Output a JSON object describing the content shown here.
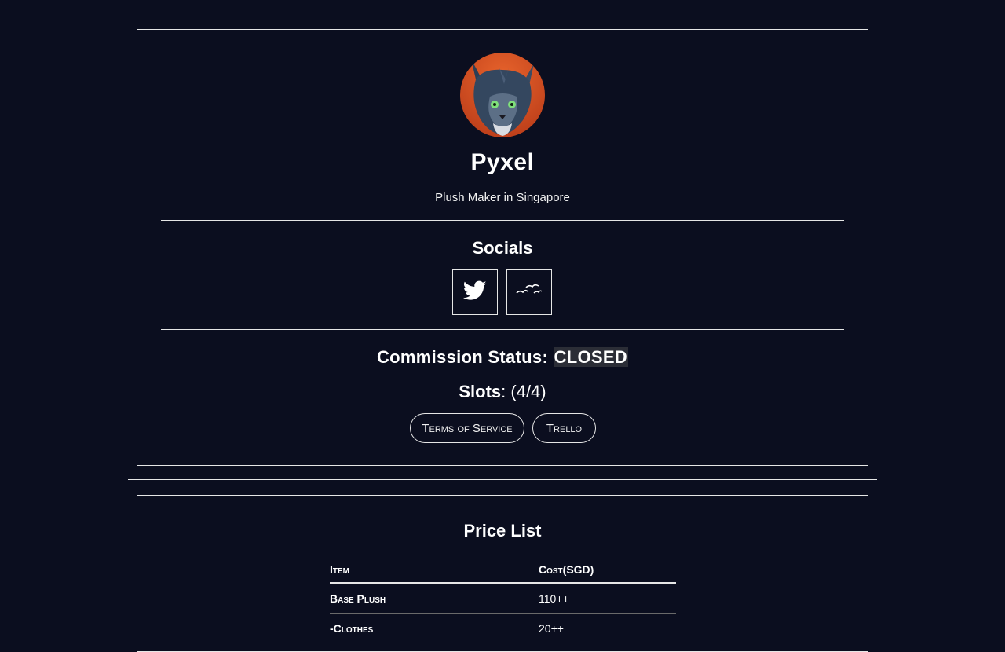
{
  "profile": {
    "name": "Pyxel",
    "subtitle": "Plush Maker in Singapore"
  },
  "socials": {
    "title": "Socials",
    "items": [
      {
        "icon": "twitter-icon"
      },
      {
        "icon": "furaffinity-icon"
      }
    ]
  },
  "commission": {
    "label": "Commission Status:",
    "status": "CLOSED",
    "slots_label": "Slots",
    "slots_value": ": (4/4)"
  },
  "links": {
    "tos": "Terms of Service",
    "trello": "Trello"
  },
  "price_list": {
    "title": "Price List",
    "headers": {
      "item": "Item",
      "cost": "Cost(SGD)"
    },
    "rows": [
      {
        "item": "Base Plush",
        "cost": "110++"
      },
      {
        "item": "-Clothes",
        "cost": "20++"
      }
    ]
  },
  "colors": {
    "background": "#0b0e1f",
    "border": "#e6e6e6",
    "status_bg": "#2b2d36"
  }
}
